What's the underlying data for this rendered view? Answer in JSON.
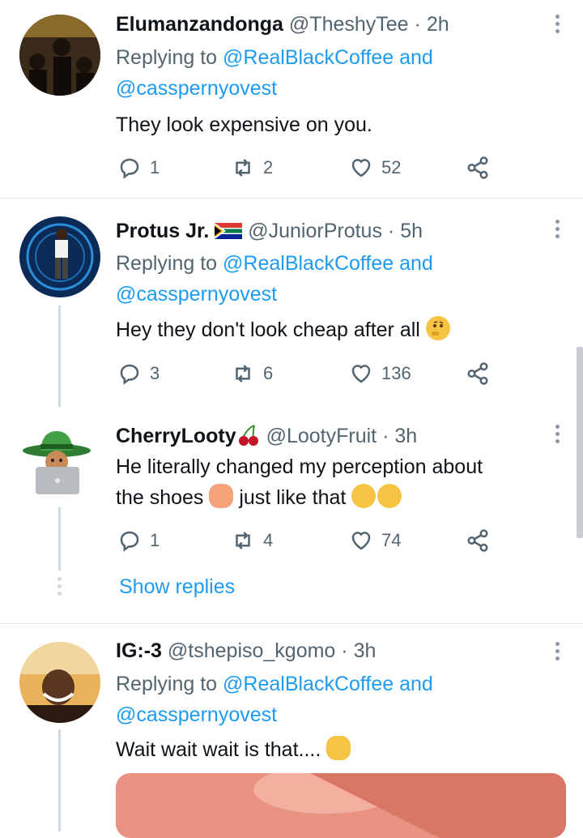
{
  "tweets": [
    {
      "name": "Elumanzandonga",
      "handle": "@TheshyTee",
      "time": "· 2h",
      "replying_prefix": "Replying to",
      "replying_line1": "@RealBlackCoffee and",
      "replying_line2": "@casspernyovest",
      "text": "They look expensive on you.",
      "replies": "1",
      "retweets": "2",
      "likes": "52"
    },
    {
      "name": "Protus Jr.",
      "handle": "@JuniorProtus",
      "time": "· 5h",
      "replying_prefix": "Replying to",
      "replying_line1": "@RealBlackCoffee and",
      "replying_line2": "@casspernyovest",
      "text": "Hey they don't look cheap after all",
      "replies": "3",
      "retweets": "6",
      "likes": "136"
    },
    {
      "name": "CherryLooty",
      "handle": "@LootyFruit",
      "time": "· 3h",
      "text_line1": "He literally changed my perception about",
      "text_line2a": "the shoes",
      "text_line2b": "just like that",
      "replies": "1",
      "retweets": "4",
      "likes": "74"
    },
    {
      "name": "IG:-3",
      "handle": "@tshepiso_kgomo",
      "time": "· 3h",
      "replying_prefix": "Replying to",
      "replying_line1": "@RealBlackCoffee and",
      "replying_line2": "@casspernyovest",
      "text": "Wait wait wait is that...."
    }
  ],
  "show_replies": "Show replies",
  "colors": {
    "link": "#1d9bf0",
    "muted": "#536471",
    "text": "#0f1419",
    "divider": "#e1e8ed"
  }
}
